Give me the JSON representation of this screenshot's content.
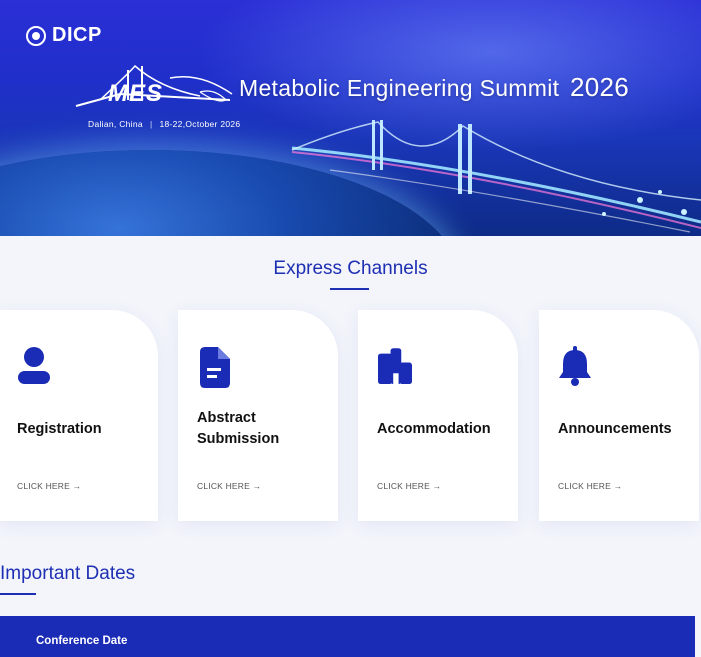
{
  "banner": {
    "org": "DICP",
    "logo_word": "MES",
    "title": "Metabolic Engineering Summit",
    "year": "2026",
    "location": "Dalian, China",
    "separator": "|",
    "dates": "18-22,October 2026"
  },
  "express": {
    "title": "Express Channels",
    "cards": [
      {
        "label": "Registration",
        "link": "CLICK HERE →",
        "icon": "user-icon"
      },
      {
        "label": "Abstract Submission",
        "link": "CLICK HERE →",
        "icon": "document-icon"
      },
      {
        "label": "Accommodation",
        "link": "CLICK HERE →",
        "icon": "building-icon"
      },
      {
        "label": "Announcements",
        "link": "CLICK HERE →",
        "icon": "bell-icon"
      }
    ]
  },
  "important_dates": {
    "title": "Important Dates",
    "first_row": "Conference Date"
  },
  "colors": {
    "accent": "#1e2fb3",
    "banner_top": "#2b2fd6",
    "date_bar": "#1a2bb5"
  }
}
